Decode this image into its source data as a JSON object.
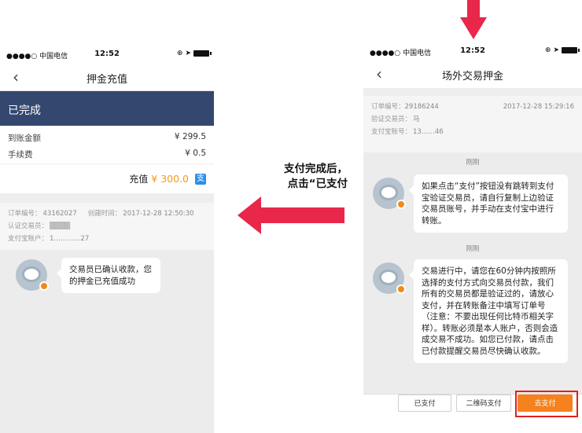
{
  "left_phone": {
    "status": {
      "carrier": "●●●●○ 中国电信",
      "time": "12:52"
    },
    "nav": {
      "title": "押金充值"
    },
    "banner": "已完成",
    "rows": [
      {
        "label": "到账金额",
        "value": "¥ 299.5"
      },
      {
        "label": "手续费",
        "value": "¥ 0.5"
      }
    ],
    "recharge": {
      "label": "充值",
      "amount": "¥ 300.0"
    },
    "order": {
      "order_no_label": "订单编号：",
      "order_no": "43162027",
      "created_label": "创建时间：",
      "created": "2017-12-28 12:50:30",
      "dealer_label": "认证交易员：",
      "alipay_label": "支付宝账户：",
      "alipay": "1…………27"
    },
    "message": "交易员已确认收款，您的押金已充值成功"
  },
  "right_phone": {
    "status": {
      "carrier": "●●●●○ 中国电信",
      "time": "12:52"
    },
    "nav": {
      "title": "场外交易押金"
    },
    "order": {
      "order_no_label": "订单编号：",
      "order_no": "29186244",
      "date": "2017-12-28 15:29:16",
      "dealer_label": "验证交易员：",
      "dealer": "马",
      "alipay_label": "支付宝账号：",
      "alipay": "13……46"
    },
    "stamp1": "刚刚",
    "message1": "如果点击“支付”按钮没有跳转到支付宝验证交易员，请自行复制上边验证交易员账号，并手动在支付宝中进行转账。",
    "stamp2": "刚刚",
    "message2": "交易进行中，请您在60分钟内按照所选择的支付方式向交易员付款，我们所有的交易员都是验证过的，请放心支付，并在转账备注中填写订单号（注意：不要出现任何比特币相关字样）。转账必须是本人账户，否则会造成交易不成功。如您已付款，请点击已付款提醒交易员尽快确认收款。",
    "buttons": {
      "paid": "已支付",
      "qr_pay": "二维码支付",
      "go_pay": "去支付"
    }
  },
  "annotation": {
    "line1": "支付完成后，",
    "line2": "点击“已支付"
  },
  "colors": {
    "arrow": "#e8274b",
    "banner": "#34476f",
    "accent": "#f5821f"
  },
  "icons": [
    "back-icon",
    "wifi-icon",
    "battery-icon",
    "alipay-icon",
    "avatar-icon",
    "arrow-left-icon",
    "arrow-down-icon"
  ]
}
